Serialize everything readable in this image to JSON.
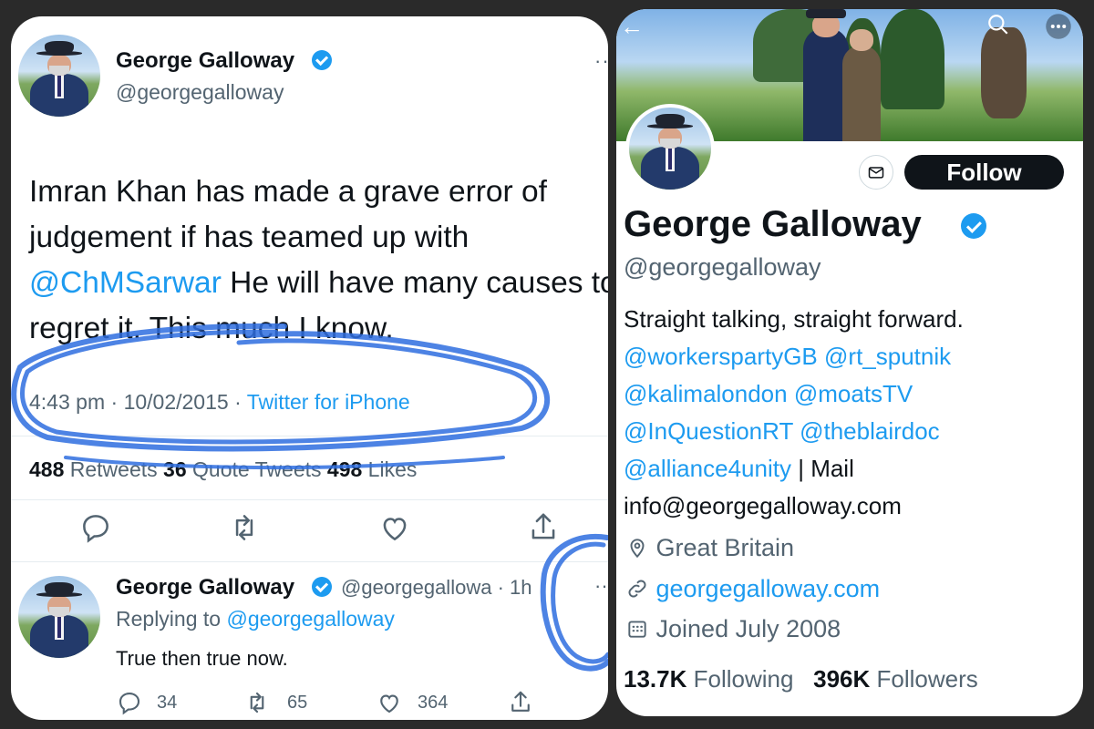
{
  "tweet": {
    "author_name": "George Galloway",
    "author_handle": "@georgegalloway",
    "text_part1": "Imran Khan has made a grave error of judgement if has teamed up with ",
    "text_mention": "@ChMSarwar",
    "text_part2": " He will have many causes to regret it. This much I know.",
    "time": "4:43 pm",
    "date": "10/02/2015",
    "source": "Twitter for iPhone",
    "retweets": "488",
    "retweets_label": "Retweets",
    "quote_tweets": "36",
    "quote_tweets_label": "Quote Tweets",
    "likes": "498",
    "likes_label": "Likes"
  },
  "reply": {
    "author_name": "George Galloway",
    "author_handle": "@georgegallowa",
    "time_sep": "·",
    "time": "1h",
    "replying_prefix": "Replying to ",
    "replying_to": "@georgegalloway",
    "text": "True then true now.",
    "reply_count": "34",
    "retweet_count": "65",
    "like_count": "364"
  },
  "profile": {
    "name": "George Galloway",
    "handle": "@georgegalloway",
    "follow_label": "Follow",
    "bio_line1": "Straight talking, straight forward.",
    "bio_mentions": [
      "@workerspartyGB",
      "@rt_sputnik",
      "@kalimalondon",
      "@moatsTV",
      "@InQuestionRT",
      "@theblairdoc",
      "@alliance4unity"
    ],
    "bio_sep": "|",
    "bio_mail_label": "Mail",
    "bio_email": "info@georgegalloway.com",
    "location": "Great Britain",
    "website": "georgegalloway.com",
    "joined": "Joined July 2008",
    "following_count": "13.7K",
    "following_label": "Following",
    "followers_count": "396K",
    "followers_label": "Followers"
  },
  "colors": {
    "accent": "#1d9bf0",
    "text": "#0f1419",
    "muted": "#536471",
    "scribble": "#2f6ee0"
  },
  "icons": [
    "verified-badge-icon",
    "more-icon",
    "reply-icon",
    "retweet-icon",
    "like-icon",
    "share-icon",
    "back-arrow-icon",
    "search-icon",
    "mail-icon",
    "location-icon",
    "link-icon",
    "calendar-icon"
  ]
}
